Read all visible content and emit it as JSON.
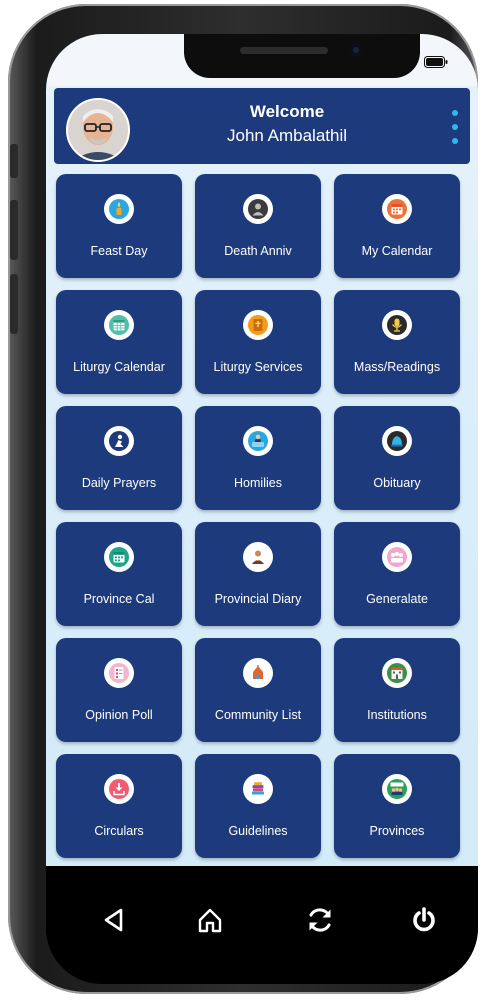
{
  "header": {
    "welcome": "Welcome",
    "user_name": "John Ambalathil"
  },
  "colors": {
    "header_bg": "#1d3a7c",
    "tile_bg": "#1d3a7c",
    "menu_dots": "#2fb8ea",
    "screen_bg": "#dbeefa"
  },
  "tiles": [
    {
      "label": "Feast Day",
      "icon": "candle-icon"
    },
    {
      "label": "Death Anniv",
      "icon": "person-silhouette-icon"
    },
    {
      "label": "My Calendar",
      "icon": "calendar-icon"
    },
    {
      "label": "Liturgy Calendar",
      "icon": "calendar-grid-icon"
    },
    {
      "label": "Liturgy Services",
      "icon": "bible-icon"
    },
    {
      "label": "Mass/Readings",
      "icon": "microphone-icon"
    },
    {
      "label": "Daily Prayers",
      "icon": "praying-person-icon"
    },
    {
      "label": "Homilies",
      "icon": "preacher-icon"
    },
    {
      "label": "Obituary",
      "icon": "bell-icon"
    },
    {
      "label": "Province Cal",
      "icon": "calendar-icon"
    },
    {
      "label": "Provincial Diary",
      "icon": "priest-icon"
    },
    {
      "label": "Generalate",
      "icon": "group-icon"
    },
    {
      "label": "Opinion Poll",
      "icon": "poll-form-icon"
    },
    {
      "label": "Community List",
      "icon": "church-icon"
    },
    {
      "label": "Institutions",
      "icon": "building-icon"
    },
    {
      "label": "Circulars",
      "icon": "download-tray-icon"
    },
    {
      "label": "Guidelines",
      "icon": "books-icon"
    },
    {
      "label": "Provinces",
      "icon": "people-board-icon"
    }
  ],
  "navbar": {
    "buttons": [
      "back-icon",
      "home-icon",
      "refresh-icon",
      "power-icon"
    ]
  }
}
